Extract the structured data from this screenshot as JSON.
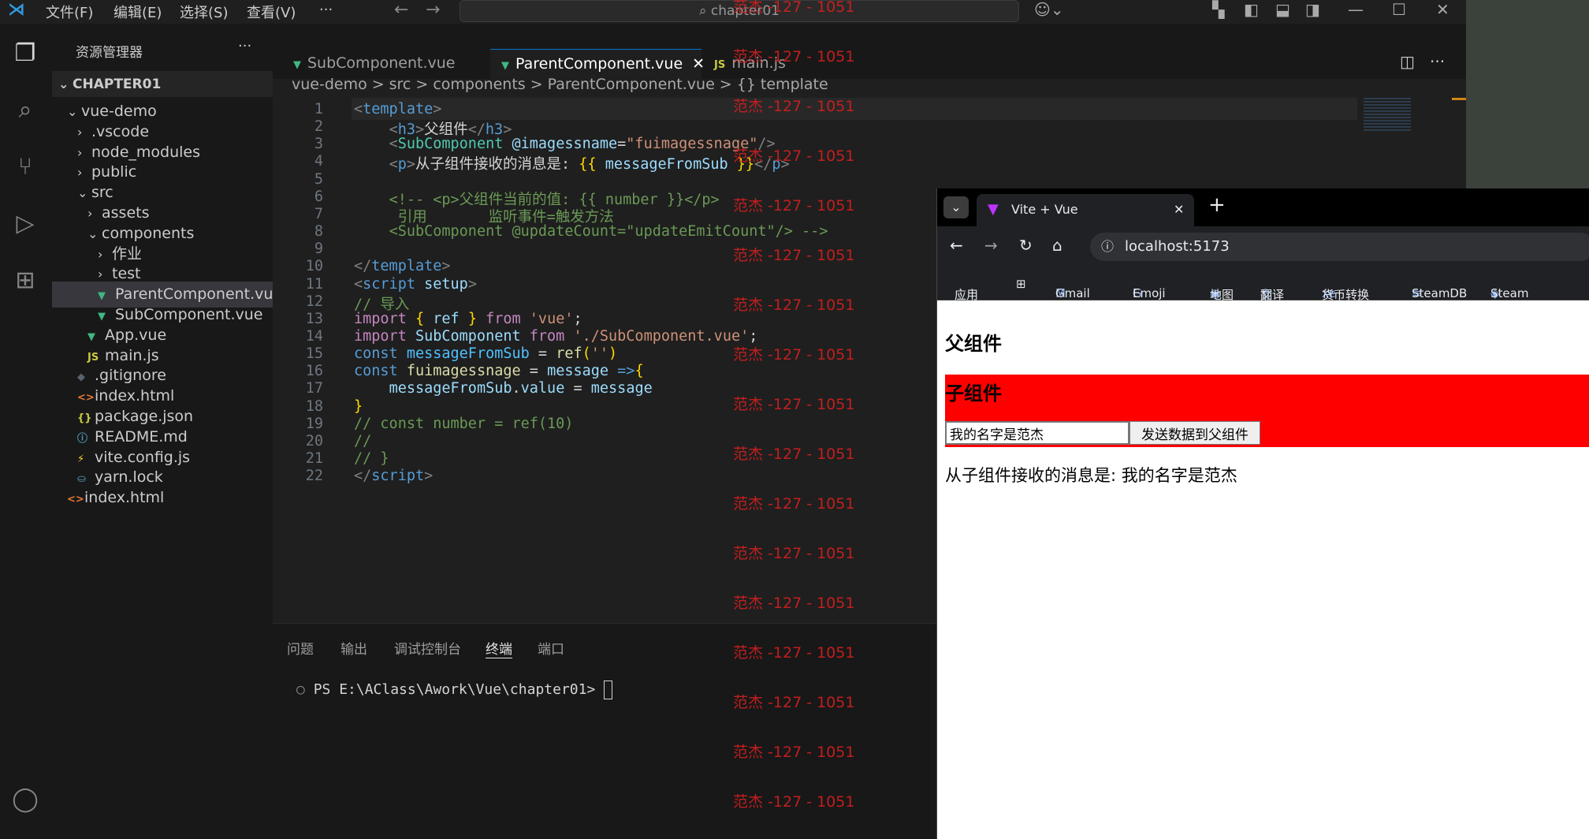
{
  "titlebar": {
    "menu": [
      "文件(F)",
      "编辑(E)",
      "选择(S)",
      "查看(V)",
      "···"
    ],
    "search": "chapter01"
  },
  "sidebar": {
    "title": "资源管理器",
    "section": "CHAPTER01",
    "items": [
      {
        "label": "vue-demo",
        "indent": 1,
        "chev": "v",
        "icon": ""
      },
      {
        "label": ".vscode",
        "indent": 2,
        "chev": ">",
        "icon": ""
      },
      {
        "label": "node_modules",
        "indent": 2,
        "chev": ">",
        "icon": ""
      },
      {
        "label": "public",
        "indent": 2,
        "chev": ">",
        "icon": ""
      },
      {
        "label": "src",
        "indent": 2,
        "chev": "v",
        "icon": ""
      },
      {
        "label": "assets",
        "indent": 3,
        "chev": ">",
        "icon": ""
      },
      {
        "label": "components",
        "indent": 3,
        "chev": "v",
        "icon": ""
      },
      {
        "label": "作业",
        "indent": 4,
        "chev": ">",
        "icon": ""
      },
      {
        "label": "test",
        "indent": 4,
        "chev": ">",
        "icon": ""
      },
      {
        "label": "ParentComponent.vue",
        "indent": 4,
        "chev": "",
        "icon": "vue",
        "sel": true
      },
      {
        "label": "SubComponent.vue",
        "indent": 4,
        "chev": "",
        "icon": "vue"
      },
      {
        "label": "App.vue",
        "indent": 3,
        "chev": "",
        "icon": "vue"
      },
      {
        "label": "main.js",
        "indent": 3,
        "chev": "",
        "icon": "js"
      },
      {
        "label": ".gitignore",
        "indent": 2,
        "chev": "",
        "icon": "git"
      },
      {
        "label": "index.html",
        "indent": 2,
        "chev": "",
        "icon": "html"
      },
      {
        "label": "package.json",
        "indent": 2,
        "chev": "",
        "icon": "json"
      },
      {
        "label": "README.md",
        "indent": 2,
        "chev": "",
        "icon": "info"
      },
      {
        "label": "vite.config.js",
        "indent": 2,
        "chev": "",
        "icon": "vite"
      },
      {
        "label": "yarn.lock",
        "indent": 2,
        "chev": "",
        "icon": "yarn"
      },
      {
        "label": "index.html",
        "indent": 1,
        "chev": "",
        "icon": "html"
      }
    ]
  },
  "tabs": [
    {
      "label": "SubComponent.vue",
      "icon": "vue"
    },
    {
      "label": "ParentComponent.vue",
      "icon": "vue",
      "active": true,
      "close": "✕"
    },
    {
      "label": "main.js",
      "icon": "js"
    }
  ],
  "breadcrumb": [
    "vue-demo",
    ">",
    "src",
    ">",
    "components",
    ">",
    "ParentComponent.vue",
    ">",
    "{} template"
  ],
  "code": [
    {
      "n": "1",
      "html": "<span style='color:#808080'>&lt;</span><span style='color:#569cd6'>template</span><span style='color:#808080'>&gt;</span>"
    },
    {
      "n": "2",
      "html": "    <span style='color:#808080'>&lt;</span><span style='color:#569cd6'>h3</span><span style='color:#808080'>&gt;</span>父组件<span style='color:#808080'>&lt;/</span><span style='color:#569cd6'>h3</span><span style='color:#808080'>&gt;</span>"
    },
    {
      "n": "3",
      "html": "    <span style='color:#808080'>&lt;</span><span style='color:#4ec9b0'>SubComponent</span> <span style='color:#9cdcfe'>@imagessname</span>=<span style='color:#ce9178'>\"fuimagessnage\"</span><span style='color:#808080'>/&gt;</span>"
    },
    {
      "n": "4",
      "html": "    <span style='color:#808080'>&lt;</span><span style='color:#569cd6'>p</span><span style='color:#808080'>&gt;</span>从子组件接收的消息是: <span style='color:#ffd700'>{{</span> <span style='color:#9cdcfe'>messageFromSub</span> <span style='color:#ffd700'>}}</span><span style='color:#808080'>&lt;/</span><span style='color:#569cd6'>p</span><span style='color:#808080'>&gt;</span>"
    },
    {
      "n": "5",
      "html": ""
    },
    {
      "n": "6",
      "html": "    <span style='color:#6a9955'>&lt;!-- &lt;p&gt;父组件当前的值: {{ number }}&lt;/p&gt;</span>"
    },
    {
      "n": "7",
      "html": "     <span style='color:#6a9955'>引用       监听事件=触发方法</span>"
    },
    {
      "n": "8",
      "html": "    <span style='color:#6a9955'>&lt;SubComponent @updateCount=\"updateEmitCount\"/&gt; --&gt;</span>"
    },
    {
      "n": "9",
      "html": ""
    },
    {
      "n": "10",
      "html": "<span style='color:#808080'>&lt;/</span><span style='color:#569cd6'>template</span><span style='color:#808080'>&gt;</span>"
    },
    {
      "n": "11",
      "html": "<span style='color:#808080'>&lt;</span><span style='color:#569cd6'>script</span> <span style='color:#9cdcfe'>setup</span><span style='color:#808080'>&gt;</span>"
    },
    {
      "n": "12",
      "html": "<span style='color:#6a9955'>// 导入</span>"
    },
    {
      "n": "13",
      "html": "<span style='color:#c586c0'>import</span> <span style='color:#ffd700'>{</span> <span style='color:#9cdcfe'>ref</span> <span style='color:#ffd700'>}</span> <span style='color:#c586c0'>from</span> <span style='color:#ce9178'>'vue'</span>;"
    },
    {
      "n": "14",
      "html": "<span style='color:#c586c0'>import</span> <span style='color:#9cdcfe'>SubComponent</span> <span style='color:#c586c0'>from</span> <span style='color:#ce9178'>'./SubComponent.vue'</span>;"
    },
    {
      "n": "15",
      "html": "<span style='color:#569cd6'>const</span> <span style='color:#4fc1ff'>messageFromSub</span> = <span style='color:#dcdcaa'>ref</span><span style='color:#ffd700'>(</span><span style='color:#ce9178'>''</span><span style='color:#ffd700'>)</span>"
    },
    {
      "n": "16",
      "html": "<span style='color:#569cd6'>const</span> <span style='color:#dcdcaa'>fuimagessnage</span> = <span style='color:#9cdcfe'>message</span> <span style='color:#569cd6'>=&gt;</span><span style='color:#ffd700'>{</span>"
    },
    {
      "n": "17",
      "html": "    <span style='color:#9cdcfe'>messageFromSub</span>.<span style='color:#9cdcfe'>value</span> = <span style='color:#9cdcfe'>message</span>"
    },
    {
      "n": "18",
      "html": "<span style='color:#ffd700'>}</span>"
    },
    {
      "n": "19",
      "html": "<span style='color:#6a9955'>// const number = ref(10)</span>"
    },
    {
      "n": "20",
      "html": "<span style='color:#6a9955'>//</span>"
    },
    {
      "n": "21",
      "html": "<span style='color:#6a9955'>// }</span>"
    },
    {
      "n": "22",
      "html": "<span style='color:#808080'>&lt;/</span><span style='color:#569cd6'>script</span><span style='color:#808080'>&gt;</span>"
    }
  ],
  "panel": {
    "tabs": [
      "问题",
      "输出",
      "调试控制台",
      "终端",
      "端口"
    ],
    "active": "终端",
    "prompt": "PS E:\\AClass\\Awork\\Vue\\chapter01> "
  },
  "watermark": "范杰 -127 - 1051",
  "browser": {
    "tab_title": "Vite + Vue",
    "tab_close": "✕",
    "new_tab": "+",
    "url": "localhost:5173",
    "bookmarks": [
      "应用",
      "Gmail",
      "Emoji",
      "地图",
      "翻译",
      "货币转换",
      "SteamDB",
      "Steam"
    ],
    "page": {
      "parent_title": "父组件",
      "child_title": "子组件",
      "input_value": "我的名字是范杰",
      "button": "发送数据到父组件",
      "message_prefix": "从子组件接收的消息是: ",
      "message_value": "我的名字是范杰"
    }
  }
}
